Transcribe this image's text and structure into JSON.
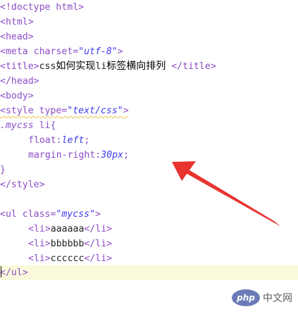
{
  "code": {
    "l1": "<!doctype html>",
    "l2": "<html>",
    "l3": "<head>",
    "l4_open": "<meta ",
    "l4_attr": "charset",
    "l4_eq": "=",
    "l4_val": "\"utf-8\"",
    "l4_close": ">",
    "l5_open": "<title>",
    "l5_css": "css",
    "l5_cjk1": "如何实现",
    "l5_li": "li",
    "l5_cjk2": "标签横向排列",
    "l5_close": " </title>",
    "l6": "</head>",
    "l7": "<body>",
    "l8_open": "<style ",
    "l8_attr": "type",
    "l8_eq": "=",
    "l8_val": "\"text/css\"",
    "l8_close": ">",
    "l9_sel": ".mycss",
    "l9_rest": " li{",
    "l10_prop": "float",
    "l10_colon": ":",
    "l10_val": "left",
    "l10_semi": ";",
    "l11_prop": "margin-right",
    "l11_colon": ":",
    "l11_val": "30px",
    "l11_semi": ";",
    "l12": "}",
    "l13": "</style>",
    "l15_open": "<ul ",
    "l15_attr": "class",
    "l15_eq": "=",
    "l15_val": "\"mycss\"",
    "l15_close": ">",
    "l16_open": "<li>",
    "l16_text": "aaaaaa",
    "l16_close": "</li>",
    "l17_open": "<li>",
    "l17_text": "bbbbbb",
    "l17_close": "</li>",
    "l18_open": "<li>",
    "l18_text": "cccccc",
    "l18_close": "</li>",
    "l19": "</ul>"
  },
  "watermark": {
    "badge": "php",
    "text": "中文网"
  },
  "colors": {
    "tag": "#8c4cc8",
    "value": "#3b3bf0",
    "active_line": "#fbf9dc",
    "arrow": "#e8332e"
  }
}
